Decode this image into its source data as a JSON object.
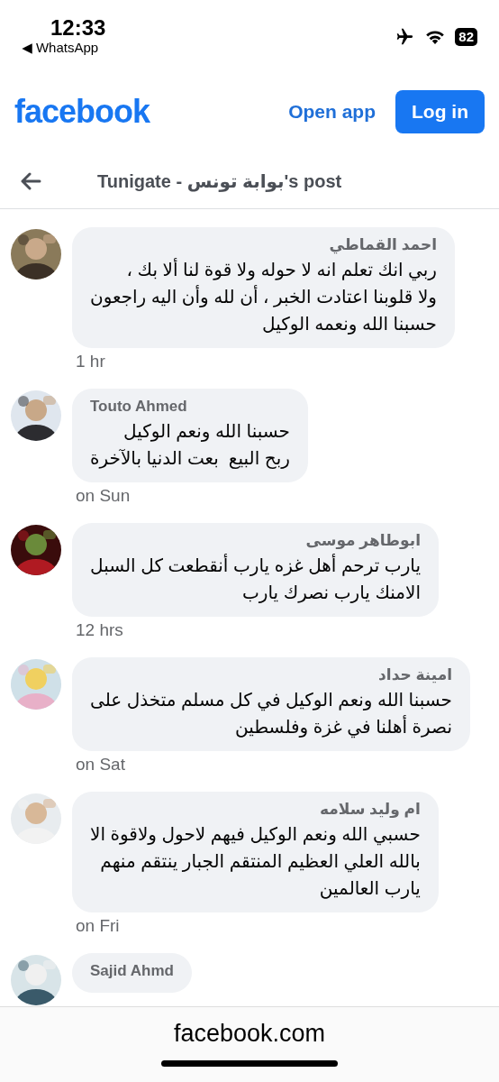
{
  "status_bar": {
    "time": "12:33",
    "back_app": "◀ WhatsApp",
    "battery": "82"
  },
  "header": {
    "logo": "facebook",
    "open_app": "Open app",
    "login": "Log in"
  },
  "post_bar": {
    "title": "Tunigate - بوابة تونس's post"
  },
  "comments": [
    {
      "author": "احمد القماطي",
      "lines": [
        "ربي انك تعلم انه لا حوله ولا قوة لنا ألا بك ،",
        "ولا قلوبنا اعتادت الخبر ، أن لله وأن اليه راجعون",
        "حسبنا الله ونعمه الوكيل"
      ],
      "time": "1 hr"
    },
    {
      "author": "Touto Ahmed",
      "lines": [
        "حسبنا الله ونعم الوكيل",
        "ربح البيع  بعت الدنيا بالآخرة"
      ],
      "time": "on Sun"
    },
    {
      "author": "ابوطاهر موسى",
      "lines": [
        "يارب ترحم أهل غزه يارب أنقطعت كل السبل",
        "الامنك يارب نصرك يارب"
      ],
      "time": "12 hrs"
    },
    {
      "author": "امينة حداد",
      "lines": [
        "حسبنا الله ونعم الوكيل في كل مسلم متخذل على",
        "نصرة أهلنا في غزة وفلسطين"
      ],
      "time": "on Sat"
    },
    {
      "author": "ام وليد سلامه",
      "lines": [
        "حسبي الله ونعم الوكيل فيهم لاحول ولاقوة الا",
        "بالله العلي العظيم المنتقم الجبار ينتقم منهم",
        "يارب العالمين"
      ],
      "time": "on Fri"
    },
    {
      "author": "Sajid Ahmd"
    }
  ],
  "browser_bar": {
    "url": "facebook.com"
  }
}
